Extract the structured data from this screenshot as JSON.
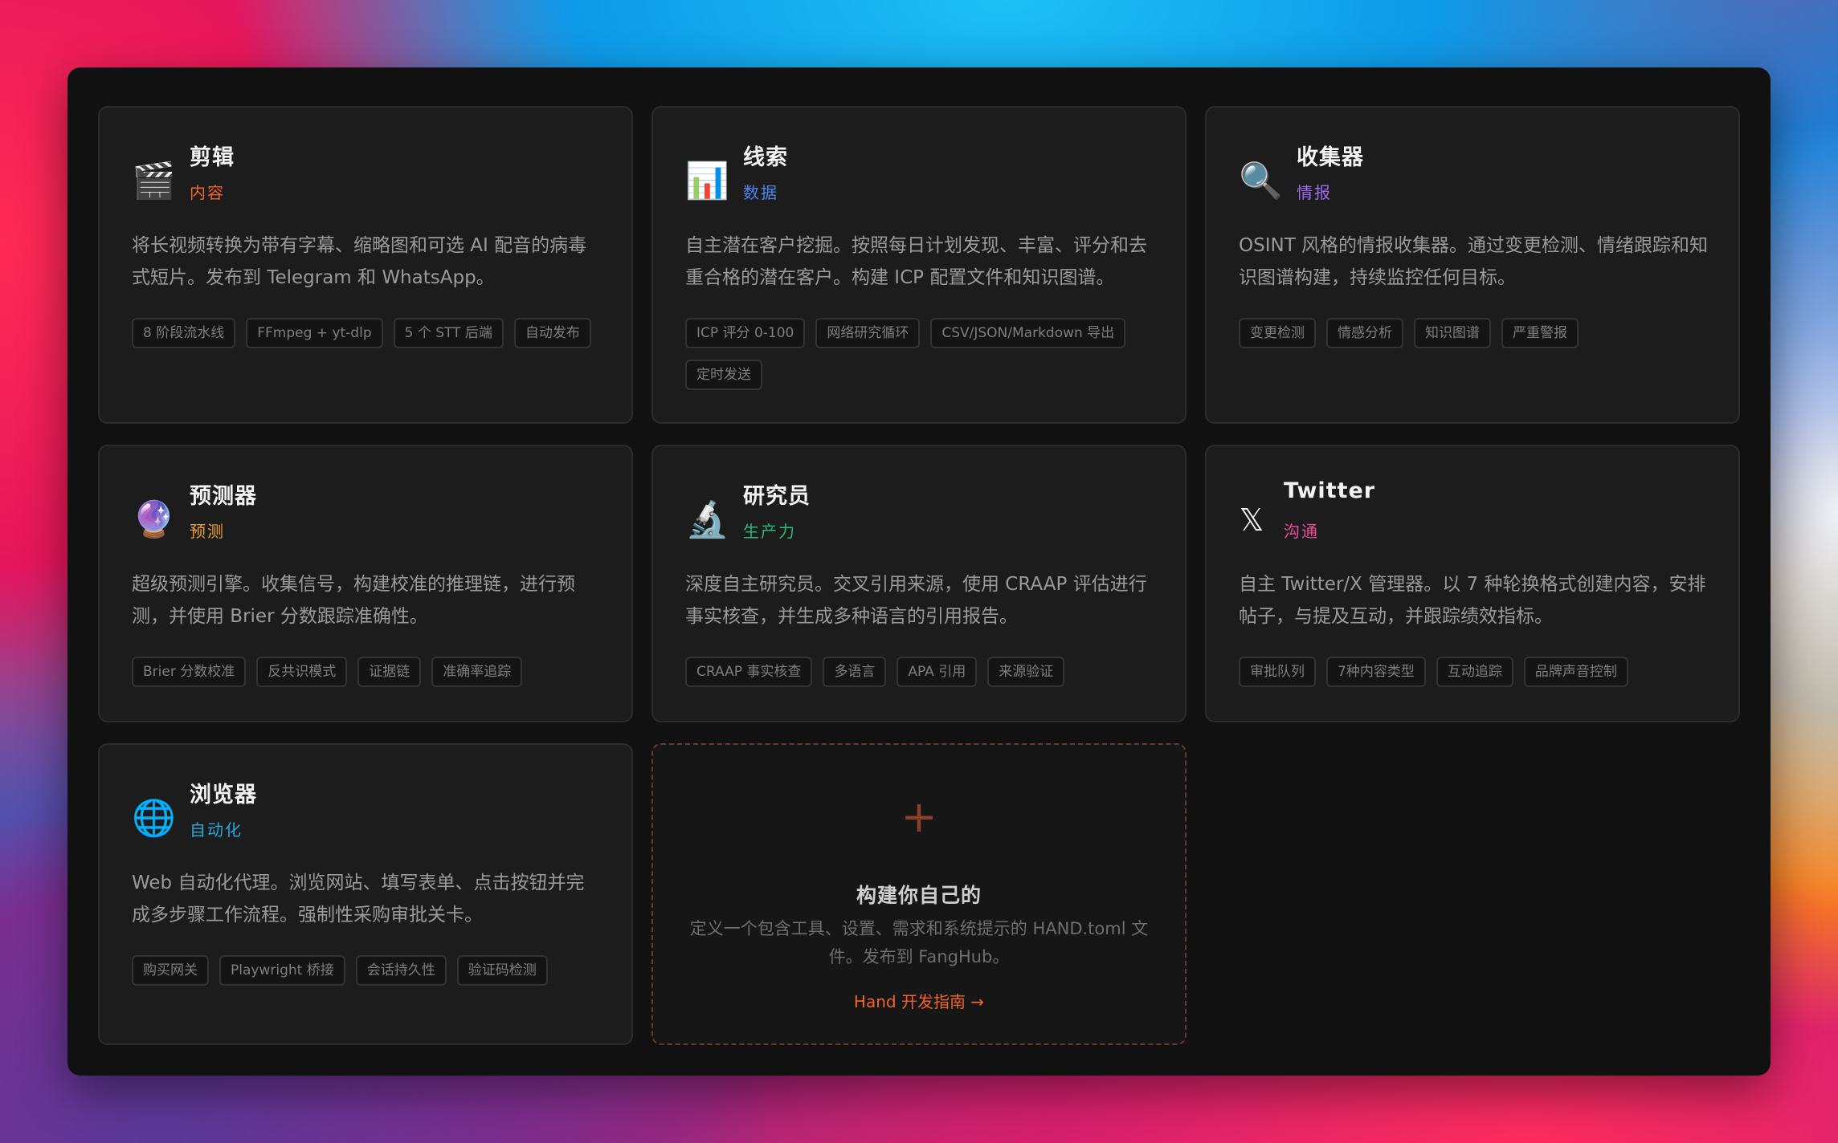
{
  "cards": [
    {
      "icon": "🎬",
      "icon_name": "clapperboard-icon",
      "title": "剪辑",
      "category": "内容",
      "category_color": "#f0642a",
      "description": "将长视频转换为带有字幕、缩略图和可选 AI 配音的病毒式短片。发布到 Telegram 和 WhatsApp。",
      "tags": [
        "8 阶段流水线",
        "FFmpeg + yt-dlp",
        "5 个 STT 后端",
        "自动发布"
      ]
    },
    {
      "icon": "📊",
      "icon_name": "bar-chart-icon",
      "title": "线索",
      "category": "数据",
      "category_color": "#4f83f0",
      "description": "自主潜在客户挖掘。按照每日计划发现、丰富、评分和去重合格的潜在客户。构建 ICP 配置文件和知识图谱。",
      "tags": [
        "ICP 评分 0-100",
        "网络研究循环",
        "CSV/JSON/Markdown 导出",
        "定时发送"
      ]
    },
    {
      "icon": "🔍",
      "icon_name": "magnifier-icon",
      "title": "收集器",
      "category": "情报",
      "category_color": "#9b6cf0",
      "description": "OSINT 风格的情报收集器。通过变更检测、情绪跟踪和知识图谱构建，持续监控任何目标。",
      "tags": [
        "变更检测",
        "情感分析",
        "知识图谱",
        "严重警报"
      ]
    },
    {
      "icon": "🔮",
      "icon_name": "crystal-ball-icon",
      "title": "预测器",
      "category": "预测",
      "category_color": "#f0a030",
      "description": "超级预测引擎。收集信号，构建校准的推理链，进行预测，并使用 Brier 分数跟踪准确性。",
      "tags": [
        "Brier 分数校准",
        "反共识模式",
        "证据链",
        "准确率追踪"
      ]
    },
    {
      "icon": "🔬",
      "icon_name": "microscope-icon",
      "title": "研究员",
      "category": "生产力",
      "category_color": "#2fb87a",
      "description": "深度自主研究员。交叉引用来源，使用 CRAAP 评估进行事实核查，并生成多种语言的引用报告。",
      "tags": [
        "CRAAP 事实核查",
        "多语言",
        "APA 引用",
        "来源验证"
      ]
    },
    {
      "icon": "𝕏",
      "icon_name": "x-logo-icon",
      "title": "Twitter",
      "category": "沟通",
      "category_color": "#ec4f9a",
      "description": "自主 Twitter/X 管理器。以 7 种轮换格式创建内容，安排帖子，与提及互动，并跟踪绩效指标。",
      "tags": [
        "审批队列",
        "7种内容类型",
        "互动追踪",
        "品牌声音控制"
      ]
    },
    {
      "icon": "🌐",
      "icon_name": "globe-icon",
      "title": "浏览器",
      "category": "自动化",
      "category_color": "#2aa8d8",
      "description": "Web 自动化代理。浏览网站、填写表单、点击按钮并完成多步骤工作流程。强制性采购审批关卡。",
      "tags": [
        "购买网关",
        "Playwright 桥接",
        "会话持久性",
        "验证码检测"
      ]
    }
  ],
  "build": {
    "plus": "+",
    "title": "构建你自己的",
    "description": "定义一个包含工具、设置、需求和系统提示的 HAND.toml 文件。发布到 FangHub。",
    "link": "Hand 开发指南 →"
  }
}
